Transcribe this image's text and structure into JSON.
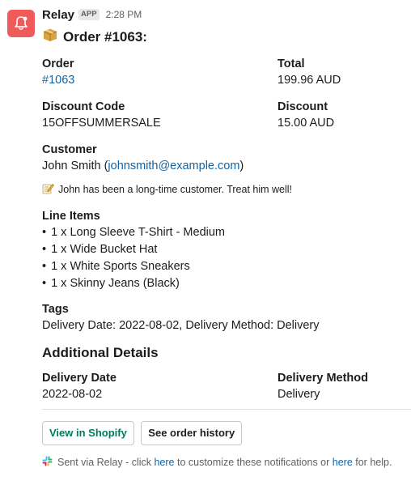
{
  "message": {
    "sender": "Relay",
    "badge": "APP",
    "time": "2:28 PM",
    "title": "Order #1063:"
  },
  "order": {
    "order_label": "Order",
    "order_value": "#1063",
    "total_label": "Total",
    "total_value": "199.96 AUD",
    "discount_code_label": "Discount Code",
    "discount_code_value": "15OFFSUMMERSALE",
    "discount_label": "Discount",
    "discount_value": "15.00 AUD",
    "customer_label": "Customer",
    "customer_name": "John Smith (",
    "customer_email": "johnsmith@example.com",
    "customer_close": ")",
    "note": "John has been a long-time customer. Treat him well!",
    "line_items_label": "Line Items",
    "line_items": [
      "1 x Long Sleeve T-Shirt - Medium",
      "1 x Wide Bucket Hat",
      "1 x White Sports Sneakers",
      "1 x Skinny Jeans (Black)"
    ],
    "tags_label": "Tags",
    "tags_value": "Delivery Date: 2022-08-02, Delivery Method: Delivery"
  },
  "additional": {
    "title": "Additional Details",
    "delivery_date_label": "Delivery Date",
    "delivery_date_value": "2022-08-02",
    "delivery_method_label": "Delivery Method",
    "delivery_method_value": "Delivery"
  },
  "buttons": {
    "view_shopify": "View in Shopify",
    "order_history": "See order history"
  },
  "footer": {
    "text_1": "Sent via Relay - click ",
    "link_1": "here",
    "text_2": " to customize these notifications or ",
    "link_2": "here",
    "text_3": " for help."
  },
  "colors": {
    "avatar_bg": "#ef5b5b",
    "link": "#1264a3",
    "button_green": "#007a5a"
  }
}
